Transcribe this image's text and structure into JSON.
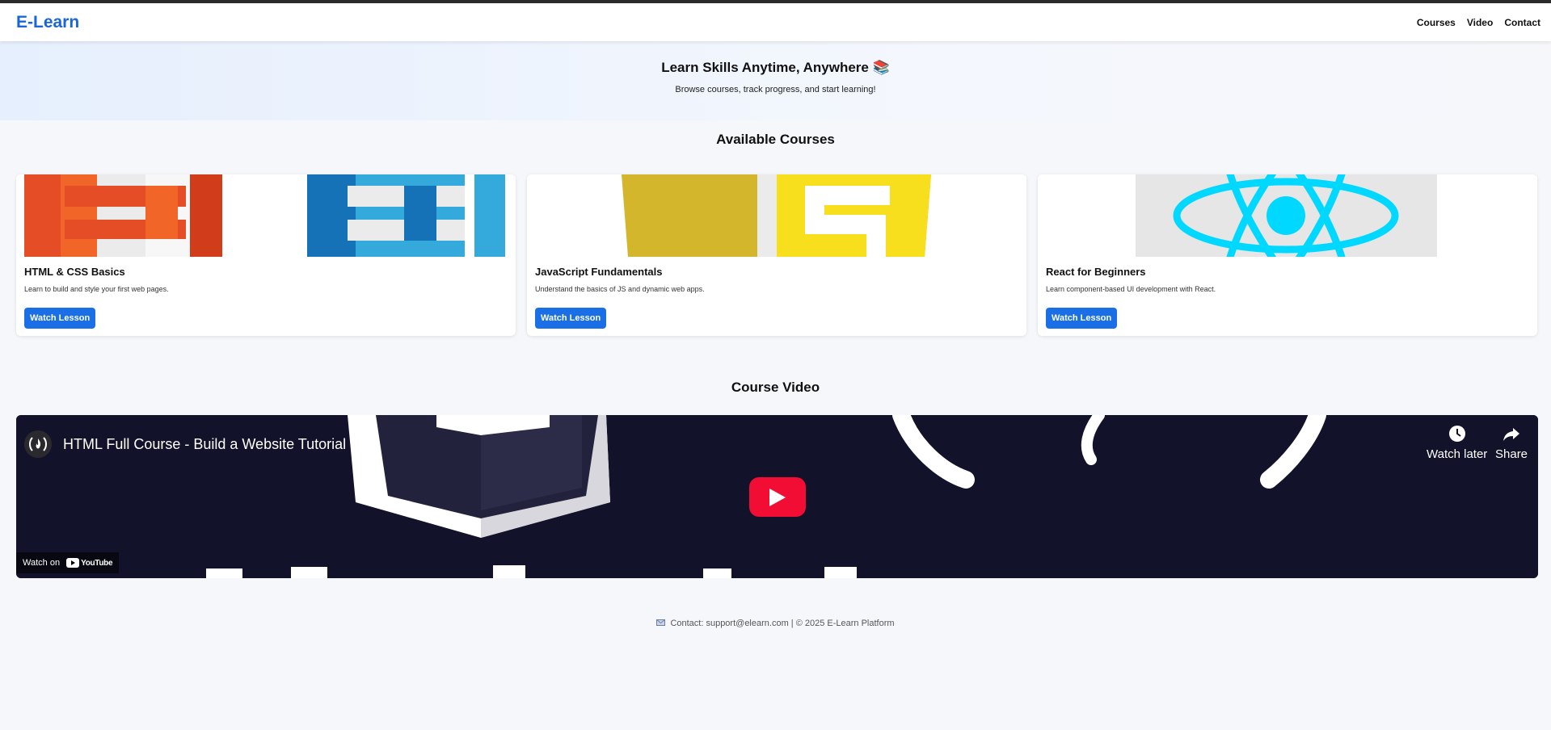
{
  "header": {
    "brand": "E-Learn",
    "nav": [
      "Courses",
      "Video",
      "Contact"
    ]
  },
  "hero": {
    "title": "Learn Skills Anytime, Anywhere 📚",
    "subtitle": "Browse courses, track progress, and start learning!"
  },
  "courses_section": {
    "title": "Available Courses",
    "cards": [
      {
        "title": "HTML & CSS Basics",
        "description": "Learn to build and style your first web pages.",
        "button": "Watch Lesson",
        "thumb": "html-css-logos"
      },
      {
        "title": "JavaScript Fundamentals",
        "description": "Understand the basics of JS and dynamic web apps.",
        "button": "Watch Lesson",
        "thumb": "javascript-logo"
      },
      {
        "title": "React for Beginners",
        "description": "Learn component-based UI development with React.",
        "button": "Watch Lesson",
        "thumb": "react-logo"
      }
    ]
  },
  "video_section": {
    "title": "Course Video",
    "video_title": "HTML Full Course - Build a Website Tutorial",
    "watch_later": "Watch later",
    "share": "Share",
    "watch_on": "Watch on",
    "youtube": "YouTube"
  },
  "footer": {
    "text": "Contact: support@elearn.com | © 2025 E-Learn Platform",
    "icon": "envelope-icon"
  },
  "colors": {
    "brand": "#1a66d9",
    "button": "#1a6fe6",
    "youtube_red": "#f10d33",
    "html_orange": "#e44d26",
    "css_blue": "#1572b6",
    "js_yellow": "#f7df1e",
    "react_cyan": "#00d8ff"
  }
}
